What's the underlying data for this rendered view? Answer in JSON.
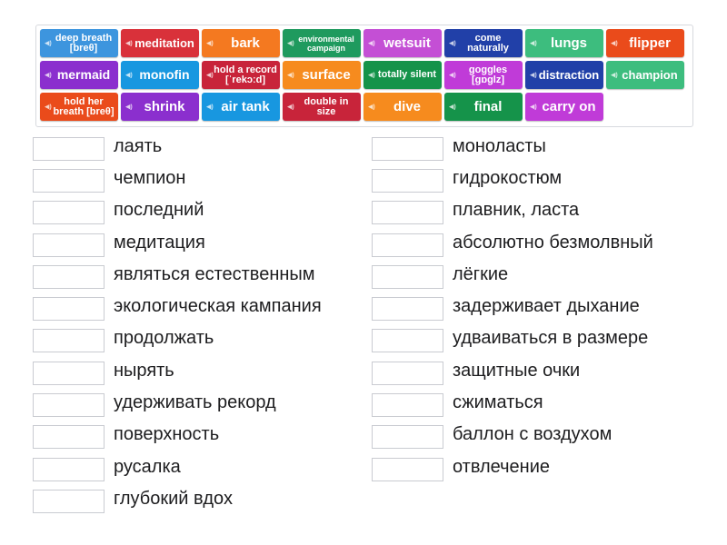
{
  "tiles": [
    {
      "id": "deep-breath",
      "label": "deep breath [breθ]",
      "color": "#3d95de"
    },
    {
      "id": "meditation",
      "label": "meditation",
      "color": "#d9313a"
    },
    {
      "id": "bark",
      "label": "bark",
      "color": "#f47920"
    },
    {
      "id": "environmental-campaign",
      "label": "environmental campaign",
      "color": "#1f9a5e"
    },
    {
      "id": "wetsuit",
      "label": "wetsuit",
      "color": "#c44fd5"
    },
    {
      "id": "come-naturally",
      "label": "come naturally",
      "color": "#2140a8"
    },
    {
      "id": "lungs",
      "label": "lungs",
      "color": "#3dbd7e"
    },
    {
      "id": "flipper",
      "label": "flipper",
      "color": "#ea4b1b"
    },
    {
      "id": "mermaid",
      "label": "mermaid",
      "color": "#8b2fce"
    },
    {
      "id": "monofin",
      "label": "monofin",
      "color": "#1897e0"
    },
    {
      "id": "hold-a-record",
      "label": "hold a record [ˈrekɔːd]",
      "color": "#c8243a"
    },
    {
      "id": "surface",
      "label": "surface",
      "color": "#f68b1e"
    },
    {
      "id": "totally-silent",
      "label": "totally silent",
      "color": "#15934a"
    },
    {
      "id": "goggles",
      "label": "goggles [gɒglz]",
      "color": "#c03bd8"
    },
    {
      "id": "distraction",
      "label": "distraction",
      "color": "#2140a8"
    },
    {
      "id": "champion",
      "label": "champion",
      "color": "#3dbd7e"
    },
    {
      "id": "hold-her-breath",
      "label": "hold her breath [breθ]",
      "color": "#ea4b1b"
    },
    {
      "id": "shrink",
      "label": "shrink",
      "color": "#8b2fce"
    },
    {
      "id": "air-tank",
      "label": "air tank",
      "color": "#1897e0"
    },
    {
      "id": "double-in-size",
      "label": "double in size",
      "color": "#c8243a"
    },
    {
      "id": "dive",
      "label": "dive",
      "color": "#f68b1e"
    },
    {
      "id": "final",
      "label": "final",
      "color": "#15934a"
    },
    {
      "id": "carry-on",
      "label": "carry on",
      "color": "#c03bd8"
    }
  ],
  "speaker_icon": "speaker-icon",
  "left_definitions": [
    "лаять",
    "чемпион",
    "последний",
    "медитация",
    "являться естественным",
    "экологическая кампания",
    "продолжать",
    "нырять",
    "удерживать рекорд",
    "поверхность",
    "русалка",
    "глубокий вдох"
  ],
  "right_definitions": [
    "моноласты",
    "гидрокостюм",
    "плавник, ласта",
    "абсолютно безмолвный",
    "лёгкие",
    "задерживает дыхание",
    "удваиваться в размере",
    "защитные очки",
    "сжиматься",
    "баллон с воздухом",
    "отвлечение"
  ]
}
